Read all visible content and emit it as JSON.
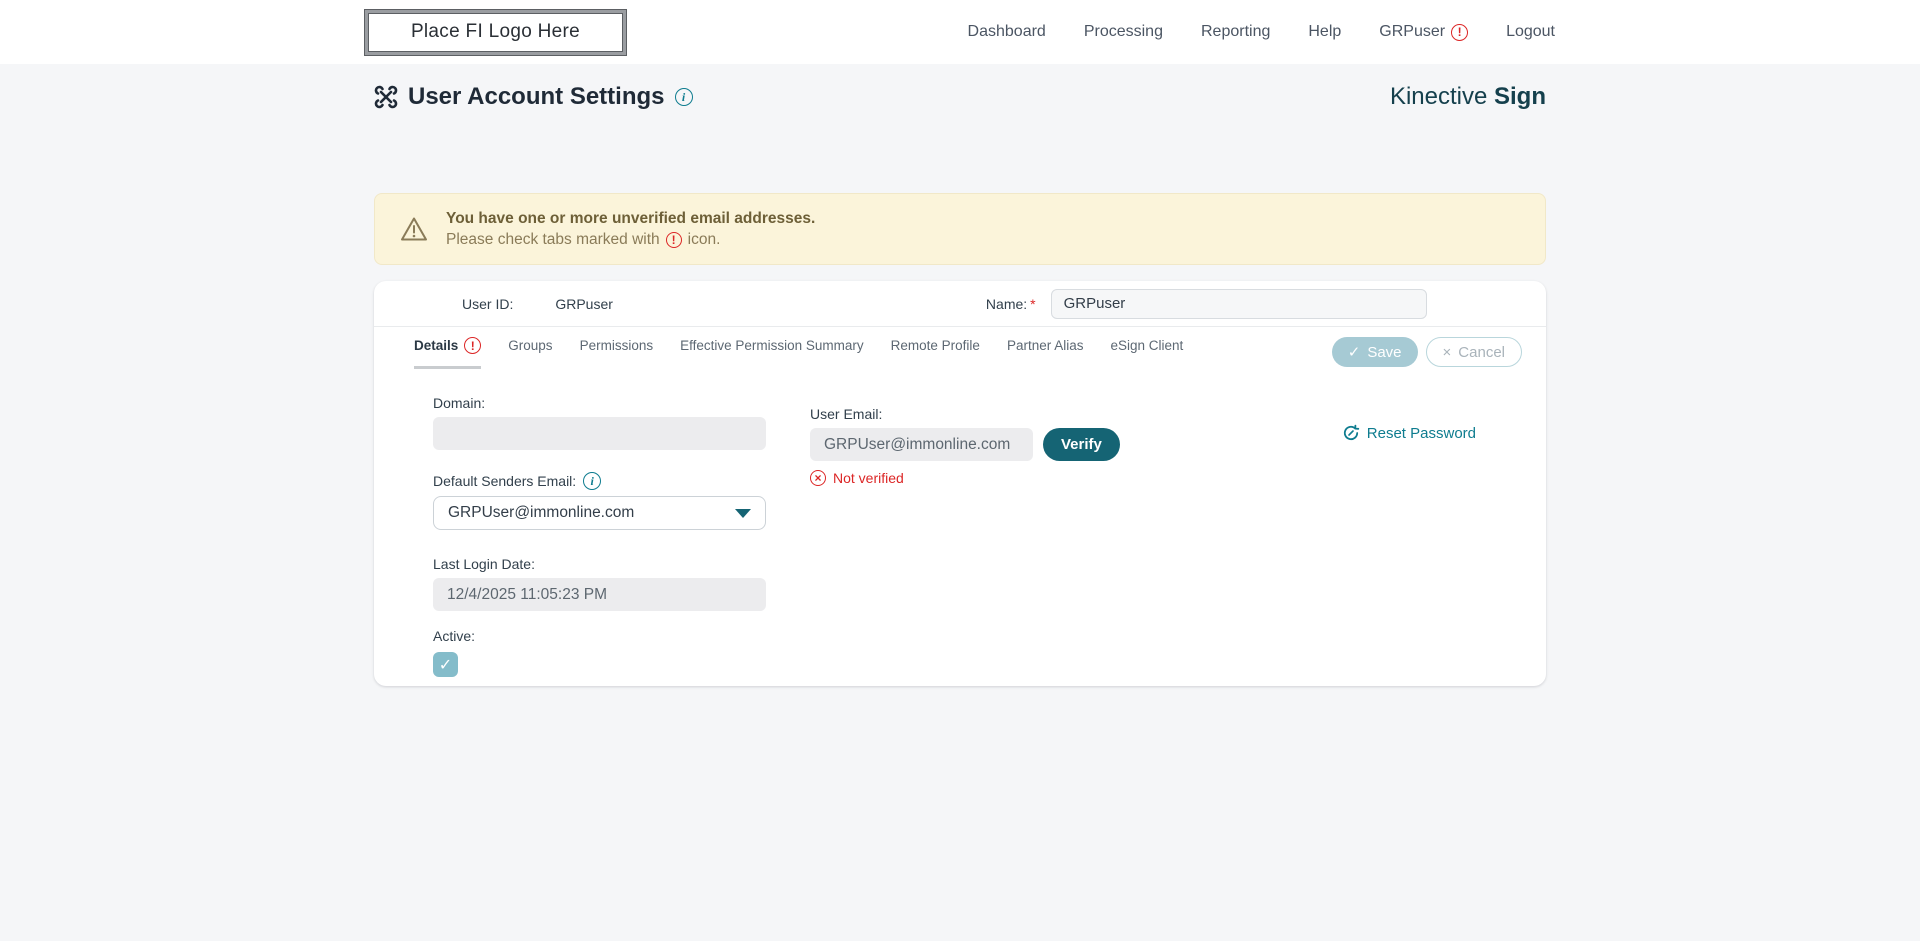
{
  "header": {
    "logo_text": "Place FI Logo Here",
    "nav": {
      "dashboard": "Dashboard",
      "processing": "Processing",
      "reporting": "Reporting",
      "help": "Help",
      "user": "GRPuser",
      "logout": "Logout"
    }
  },
  "page": {
    "title": "User Account Settings",
    "brand_name": "Kinective",
    "brand_product": "Sign"
  },
  "banner": {
    "title": "You have one or more unverified email addresses.",
    "line2_before": "Please check tabs marked with",
    "line2_after": "icon."
  },
  "account": {
    "user_id_label": "User ID:",
    "user_id_value": "GRPuser",
    "name_label": "Name:",
    "required_mark": "*",
    "name_value": "GRPuser"
  },
  "tabs": [
    "Details",
    "Groups",
    "Permissions",
    "Effective Permission Summary",
    "Remote Profile",
    "Partner Alias",
    "eSign Client"
  ],
  "actions": {
    "save": "Save",
    "cancel": "Cancel"
  },
  "form": {
    "domain_label": "Domain:",
    "domain_value": "",
    "default_senders_label": "Default Senders Email:",
    "default_senders_value": "GRPUser@immonline.com",
    "last_login_label": "Last Login Date:",
    "last_login_value": "12/4/2025 11:05:23 PM",
    "active_label": "Active:",
    "active_checked": "true",
    "user_email_label": "User Email:",
    "user_email_value": "GRPUser@immonline.com",
    "verify_label": "Verify",
    "not_verified_label": "Not verified",
    "reset_password_label": "Reset Password"
  },
  "colors": {
    "accent_teal": "#156474",
    "link_teal": "#0e7c8f",
    "error_red": "#dc2626",
    "banner_bg": "#fbf4da",
    "banner_text": "#8a7b58",
    "page_bg": "#f5f6f8",
    "brand_navy": "#15404d",
    "save_disabled_bg": "#a6cad4"
  }
}
